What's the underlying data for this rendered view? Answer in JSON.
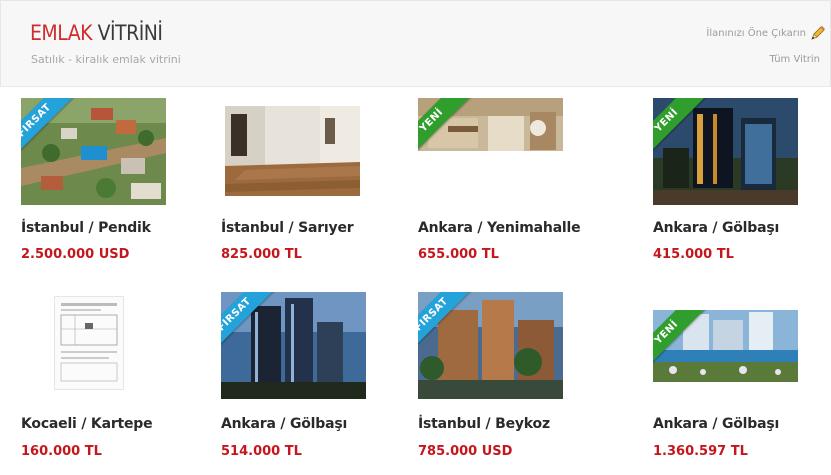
{
  "header": {
    "title_part1": "EMLAK",
    "title_part2": "VİTRİNİ",
    "subtitle": "Satılık - kiralık emlak vitrini",
    "promo_label": "İlanınızı Öne Çıkarın",
    "all_label": "Tüm Vitrin"
  },
  "colors": {
    "accent": "#cf2d2d",
    "price": "#c4161c",
    "ribbon_firsat": "#23a3d9",
    "ribbon_yeni": "#2f9e2c"
  },
  "listings": [
    {
      "location": "İstanbul / Pendik",
      "price": "2.500.000 USD",
      "badge": "FIRSAT",
      "image": "aerial-houses-photo"
    },
    {
      "location": "İstanbul / Sarıyer",
      "price": "825.000 TL",
      "badge": "",
      "image": "empty-room-photo"
    },
    {
      "location": "Ankara / Yenimahalle",
      "price": "655.000 TL",
      "badge": "YENİ",
      "image": "kitchen-photo"
    },
    {
      "location": "Ankara / Gölbaşı",
      "price": "415.000 TL",
      "badge": "YENİ",
      "image": "tower-photo"
    },
    {
      "location": "Kocaeli / Kartepe",
      "price": "160.000 TL",
      "badge": "",
      "image": "plan-document"
    },
    {
      "location": "Ankara / Gölbaşı",
      "price": "514.000 TL",
      "badge": "FIRSAT",
      "image": "tower-photo"
    },
    {
      "location": "İstanbul / Beykoz",
      "price": "785.000 USD",
      "badge": "FIRSAT",
      "image": "residence-photo"
    },
    {
      "location": "Ankara / Gölbaşı",
      "price": "1.360.597 TL",
      "badge": "YENİ",
      "image": "pool-complex-photo"
    }
  ]
}
